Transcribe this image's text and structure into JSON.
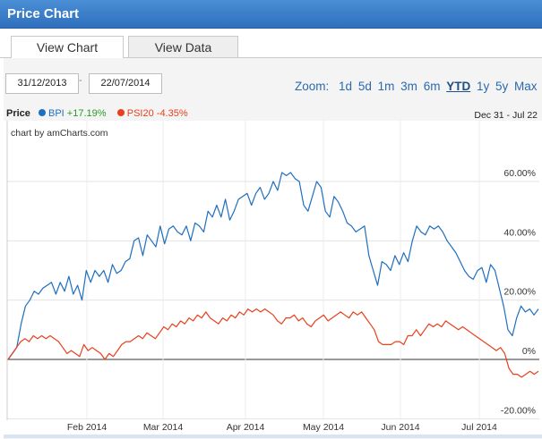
{
  "window": {
    "title": "Price Chart"
  },
  "tabs": {
    "view_chart": "View Chart",
    "view_data": "View Data"
  },
  "controls": {
    "date_from": "31/12/2013",
    "date_to": "22/07/2014",
    "zoom_label": "Zoom:",
    "zoom_options": [
      "1d",
      "5d",
      "1m",
      "3m",
      "6m",
      "YTD",
      "1y",
      "5y",
      "Max"
    ],
    "zoom_selected": "YTD"
  },
  "legend": {
    "label": "Price",
    "series": [
      {
        "name": "BPI",
        "change": "+17.19%",
        "color": "#1f6fbf"
      },
      {
        "name": "PSI20",
        "change": "-4.35%",
        "color": "#e8401c"
      }
    ],
    "range": "Dec 31 - Jul 22"
  },
  "credit": "chart by amCharts.com",
  "chart_data": {
    "type": "line",
    "x_ticks": [
      "Feb 2014",
      "Mar 2014",
      "Apr 2014",
      "May 2014",
      "Jun 2014",
      "Jul 2014"
    ],
    "y_ticks": [
      "60.00%",
      "40.00%",
      "20.00%",
      "0%",
      "-20.00%"
    ],
    "ylim": [
      -20,
      70
    ],
    "series": [
      {
        "name": "BPI",
        "color": "#1f6fbf",
        "values": [
          0,
          2,
          4,
          12,
          18,
          20,
          23,
          22,
          24,
          25,
          26,
          22,
          26,
          23,
          28,
          22,
          25,
          20,
          30,
          26,
          30,
          28,
          30,
          26,
          32,
          29,
          30,
          33,
          34,
          40,
          41,
          35,
          42,
          40,
          38,
          45,
          39,
          44,
          45,
          43,
          42,
          45,
          40,
          46,
          45,
          43,
          50,
          48,
          52,
          48,
          54,
          47,
          50,
          54,
          55,
          56,
          52,
          56,
          58,
          54,
          56,
          60,
          57,
          63,
          62,
          63,
          61,
          60,
          52,
          50,
          55,
          60,
          58,
          50,
          48,
          55,
          53,
          50,
          46,
          45,
          43,
          44,
          45,
          35,
          30,
          25,
          33,
          32,
          30,
          35,
          32,
          36,
          33,
          40,
          45,
          43,
          42,
          45,
          44,
          45,
          43,
          40,
          38,
          36,
          33,
          30,
          28,
          27,
          30,
          31,
          26,
          32,
          30,
          24,
          18,
          10,
          8,
          14,
          18,
          16,
          17,
          15,
          17
        ]
      },
      {
        "name": "PSI20",
        "color": "#e8401c",
        "values": [
          0,
          2,
          4,
          6,
          7,
          6,
          8,
          7,
          8,
          7,
          8,
          7,
          6,
          4,
          2,
          3,
          2,
          1,
          5,
          3,
          4,
          3,
          2,
          0,
          2,
          1,
          3,
          5,
          6,
          6,
          7,
          8,
          7,
          9,
          8,
          7,
          9,
          11,
          10,
          12,
          11,
          13,
          12,
          14,
          13,
          15,
          14,
          16,
          14,
          13,
          12,
          14,
          13,
          15,
          14,
          16,
          15,
          17,
          16,
          17,
          16,
          17,
          16,
          15,
          13,
          12,
          14,
          14,
          15,
          13,
          14,
          12,
          11,
          13,
          14,
          15,
          13,
          14,
          15,
          16,
          15,
          14,
          16,
          15,
          16,
          14,
          12,
          10,
          6,
          5,
          5,
          5,
          6,
          6,
          5,
          8,
          8,
          10,
          8,
          10,
          12,
          11,
          12,
          11,
          13,
          12,
          11,
          10,
          11,
          10,
          9,
          8,
          7,
          6,
          5,
          4,
          3,
          4,
          2,
          -3,
          -5,
          -5,
          -6,
          -5,
          -4,
          -5,
          -4
        ]
      }
    ]
  }
}
